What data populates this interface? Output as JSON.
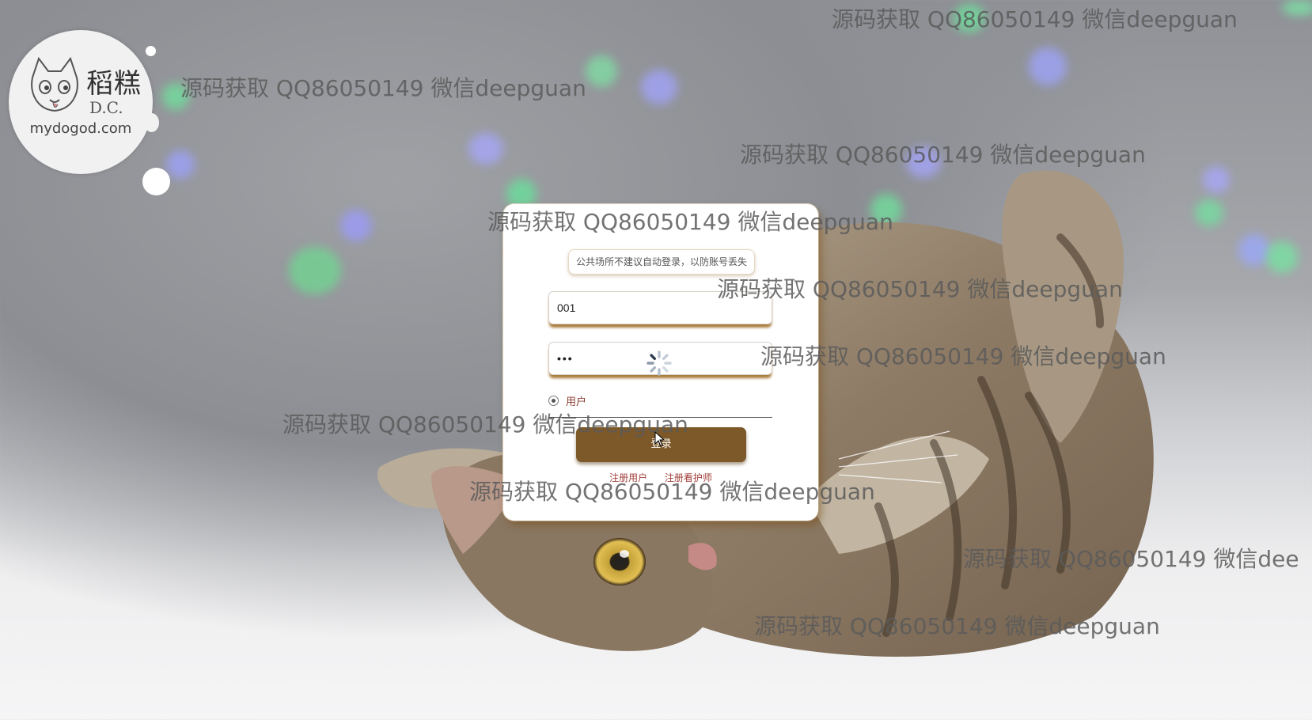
{
  "logo": {
    "name": "稻糕",
    "sub": "D.C.",
    "site": "mydogod.com"
  },
  "login": {
    "notice": "公共场所不建议自动登录，以防账号丢失",
    "username_value": "001",
    "password_value": "•••",
    "role_label": "用户",
    "login_button": "登录",
    "register_user": "注册用户",
    "register_caregiver": "注册看护师"
  },
  "watermark": {
    "text": "源码获取 QQ86050149 微信deepguan",
    "text_cut": "源码获取 QQ86050149 微信dee"
  },
  "colors": {
    "button": "#7d5828",
    "link": "#a2403a",
    "shadow": "#a87b3a"
  }
}
